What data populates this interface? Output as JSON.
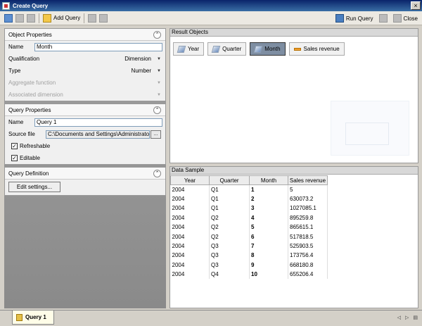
{
  "window": {
    "title": "Create Query",
    "close_glyph": "×"
  },
  "toolbar": {
    "add_query_label": "Add Query",
    "run_query_label": "Run Query",
    "close_label": "Close"
  },
  "object_properties": {
    "title": "Object Properties",
    "name_label": "Name",
    "name_value": "Month",
    "qualification_label": "Qualification",
    "qualification_value": "Dimension",
    "type_label": "Type",
    "type_value": "Number",
    "aggregate_label": "Aggregate function",
    "associated_label": "Associated dimension"
  },
  "query_properties": {
    "title": "Query Properties",
    "name_label": "Name",
    "name_value": "Query 1",
    "source_label": "Source file",
    "source_value": "C:\\Documents and Settings\\Administrator",
    "browse_label": "...",
    "refreshable_label": "Refreshable",
    "editable_label": "Editable"
  },
  "query_definition": {
    "title": "Query Definition",
    "edit_label": "Edit settings..."
  },
  "result_objects": {
    "title": "Result Objects",
    "chips": [
      {
        "label": "Year",
        "kind": "dimension",
        "selected": false
      },
      {
        "label": "Quarter",
        "kind": "dimension",
        "selected": false
      },
      {
        "label": "Month",
        "kind": "dimension",
        "selected": true
      },
      {
        "label": "Sales revenue",
        "kind": "measure",
        "selected": false
      }
    ]
  },
  "data_sample": {
    "title": "Data Sample",
    "columns": [
      "Year",
      "Quarter",
      "Month",
      "Sales revenue"
    ],
    "rows": [
      [
        "2004",
        "Q1",
        "1",
        "5"
      ],
      [
        "2004",
        "Q1",
        "2",
        "630073.2"
      ],
      [
        "2004",
        "Q1",
        "3",
        "1027085.1"
      ],
      [
        "2004",
        "Q2",
        "4",
        "895259.8"
      ],
      [
        "2004",
        "Q2",
        "5",
        "865615.1"
      ],
      [
        "2004",
        "Q2",
        "6",
        "517818.5"
      ],
      [
        "2004",
        "Q3",
        "7",
        "525903.5"
      ],
      [
        "2004",
        "Q3",
        "8",
        "173756.4"
      ],
      [
        "2004",
        "Q3",
        "9",
        "668180.8"
      ],
      [
        "2004",
        "Q4",
        "10",
        "655206.4"
      ]
    ]
  },
  "status_tab": {
    "label": "Query 1"
  },
  "colors": {
    "title_bar": "#0a246a",
    "selected_chip": "#7e8ea2",
    "measure": "#f0a030"
  },
  "icons": {
    "app": "app-icon",
    "add_query": "folder-icon",
    "run": "run-icon",
    "dimension": "dimension-icon",
    "measure": "measure-icon",
    "collapse": "chevron-up-icon"
  }
}
